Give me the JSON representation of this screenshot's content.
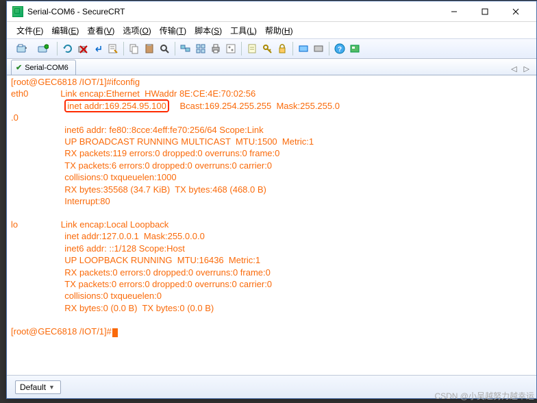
{
  "window": {
    "title": "Serial-COM6 - SecureCRT"
  },
  "menu": {
    "file": "文件",
    "file_k": "F",
    "edit": "编辑",
    "edit_k": "E",
    "view": "查看",
    "view_k": "V",
    "options": "选项",
    "options_k": "O",
    "transfer": "传输",
    "transfer_k": "T",
    "script": "脚本",
    "script_k": "S",
    "tools": "工具",
    "tools_k": "L",
    "help": "帮助",
    "help_k": "H"
  },
  "tab": {
    "name": "Serial-COM6"
  },
  "status": {
    "profile": "Default"
  },
  "terminal": {
    "prompt1_pre": "[root@GEC6818 /IOT/1]#",
    "cmd": "ifconfig",
    "eth_if": "eth0",
    "eth_l1_a": "Link encap:Ethernet  HWaddr 8E:CE:4E:70:02:56",
    "eth_hl": "inet addr:169.254.95.100",
    "eth_l2_b": "Bcast:169.254.255.255  Mask:255.255.0",
    "eth_l2_c": ".0",
    "eth_l3": "inet6 addr: fe80::8cce:4eff:fe70:256/64 Scope:Link",
    "eth_l4": "UP BROADCAST RUNNING MULTICAST  MTU:1500  Metric:1",
    "eth_l5": "RX packets:119 errors:0 dropped:0 overruns:0 frame:0",
    "eth_l6": "TX packets:6 errors:0 dropped:0 overruns:0 carrier:0",
    "eth_l7": "collisions:0 txqueuelen:1000",
    "eth_l8": "RX bytes:35568 (34.7 KiB)  TX bytes:468 (468.0 B)",
    "eth_l9": "Interrupt:80",
    "lo_if": "lo",
    "lo_l1": "Link encap:Local Loopback",
    "lo_l2": "inet addr:127.0.0.1  Mask:255.0.0.0",
    "lo_l3": "inet6 addr: ::1/128 Scope:Host",
    "lo_l4": "UP LOOPBACK RUNNING  MTU:16436  Metric:1",
    "lo_l5": "RX packets:0 errors:0 dropped:0 overruns:0 frame:0",
    "lo_l6": "TX packets:0 errors:0 dropped:0 overruns:0 carrier:0",
    "lo_l7": "collisions:0 txqueuelen:0",
    "lo_l8": "RX bytes:0 (0.0 B)  TX bytes:0 (0.0 B)",
    "prompt2": "[root@GEC6818 /IOT/1]#"
  },
  "watermark": "CSDN @小吴越努力越幸运"
}
